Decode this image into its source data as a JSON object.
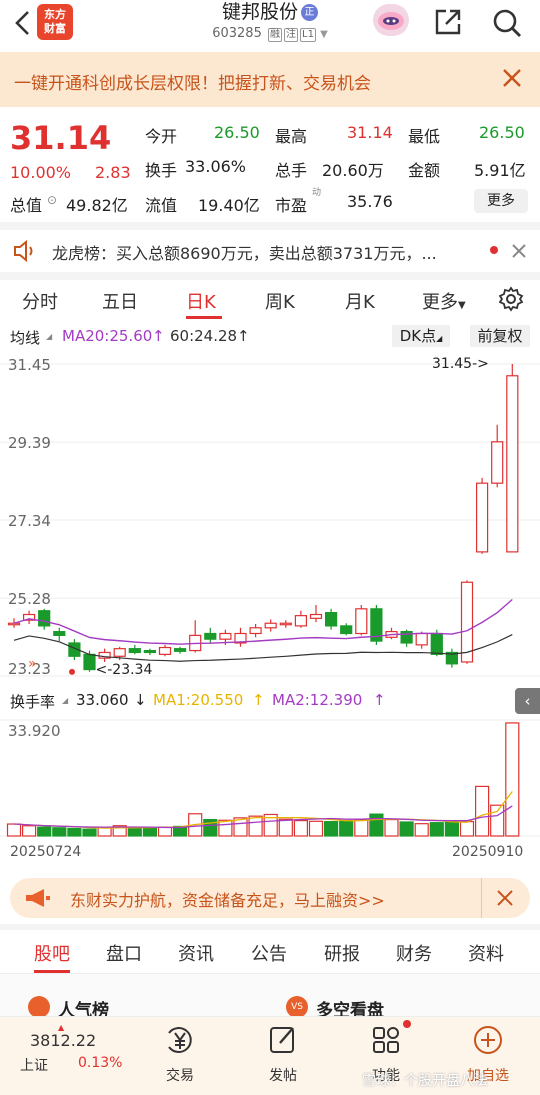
{
  "header": {
    "logo_text_1": "东方",
    "logo_text_2": "财富",
    "stock_name": "键邦股份",
    "name_badge": "正",
    "stock_code": "603285",
    "tags": [
      "融",
      "注",
      "L1"
    ]
  },
  "banner": {
    "text": "一键开通科创成长层权限！把握打新、交易机会"
  },
  "quote": {
    "price": "31.14",
    "change_pct": "10.00%",
    "change_amt": "2.83",
    "open_label": "今开",
    "open": "26.50",
    "high_label": "最高",
    "high": "31.14",
    "low_label": "最低",
    "low": "26.50",
    "turnover_label": "换手",
    "turnover": "33.06%",
    "volume_label": "总手",
    "volume": "20.60万",
    "amount_label": "金额",
    "amount": "5.91亿",
    "mktcap_label": "总值",
    "mktcap": "49.82亿",
    "float_label": "流值",
    "float": "19.40亿",
    "pe_label": "市盈",
    "pe_sup": "动",
    "pe": "35.76",
    "more": "更多"
  },
  "dragon_tiger": {
    "text": "龙虎榜：买入总额8690万元，卖出总额3731万元，..."
  },
  "period_tabs": [
    "分时",
    "五日",
    "日K",
    "周K",
    "月K",
    "更多"
  ],
  "chart_header": {
    "ma_label": "均线",
    "ma20": "MA20:25.60",
    "ma60": "60:24.28",
    "dk_label": "DK点",
    "adjust_label": "前复权"
  },
  "chart_data": {
    "type": "candlestick",
    "y_ticks": [
      "31.45",
      "29.39",
      "27.34",
      "25.28",
      "23.23"
    ],
    "ylim": [
      23.23,
      31.45
    ],
    "max_label": "31.45->",
    "min_label": "<-23.34",
    "candles": [
      {
        "o": 24.62,
        "c": 24.62,
        "h": 24.75,
        "l": 24.5
      },
      {
        "o": 24.7,
        "c": 24.85,
        "h": 24.95,
        "l": 24.6
      },
      {
        "o": 24.95,
        "c": 24.55,
        "h": 25.0,
        "l": 24.45
      },
      {
        "o": 24.4,
        "c": 24.3,
        "h": 24.5,
        "l": 24.15
      },
      {
        "o": 24.1,
        "c": 23.75,
        "h": 24.2,
        "l": 23.65
      },
      {
        "o": 23.8,
        "c": 23.4,
        "h": 23.9,
        "l": 23.34
      },
      {
        "o": 23.7,
        "c": 23.85,
        "h": 23.95,
        "l": 23.6
      },
      {
        "o": 23.75,
        "c": 23.95,
        "h": 24.0,
        "l": 23.65
      },
      {
        "o": 23.95,
        "c": 23.85,
        "h": 24.05,
        "l": 23.8
      },
      {
        "o": 23.9,
        "c": 23.85,
        "h": 23.95,
        "l": 23.78
      },
      {
        "o": 23.8,
        "c": 23.98,
        "h": 24.05,
        "l": 23.75
      },
      {
        "o": 23.95,
        "c": 23.88,
        "h": 24.0,
        "l": 23.82
      },
      {
        "o": 23.9,
        "c": 24.3,
        "h": 24.7,
        "l": 23.85
      },
      {
        "o": 24.35,
        "c": 24.2,
        "h": 24.5,
        "l": 24.1
      },
      {
        "o": 24.2,
        "c": 24.35,
        "h": 24.45,
        "l": 24.05
      },
      {
        "o": 24.1,
        "c": 24.35,
        "h": 24.5,
        "l": 24.0
      },
      {
        "o": 24.35,
        "c": 24.5,
        "h": 24.6,
        "l": 24.25
      },
      {
        "o": 24.5,
        "c": 24.62,
        "h": 24.72,
        "l": 24.4
      },
      {
        "o": 24.62,
        "c": 24.62,
        "h": 24.7,
        "l": 24.5
      },
      {
        "o": 24.55,
        "c": 24.82,
        "h": 24.95,
        "l": 24.5
      },
      {
        "o": 24.75,
        "c": 24.85,
        "h": 25.1,
        "l": 24.65
      },
      {
        "o": 24.9,
        "c": 24.55,
        "h": 25.0,
        "l": 24.45
      },
      {
        "o": 24.55,
        "c": 24.35,
        "h": 24.62,
        "l": 24.3
      },
      {
        "o": 24.35,
        "c": 25.0,
        "h": 25.1,
        "l": 24.3
      },
      {
        "o": 25.0,
        "c": 24.15,
        "h": 25.1,
        "l": 24.05
      },
      {
        "o": 24.25,
        "c": 24.4,
        "h": 24.5,
        "l": 24.2
      },
      {
        "o": 24.4,
        "c": 24.1,
        "h": 24.45,
        "l": 24.0
      },
      {
        "o": 24.05,
        "c": 24.35,
        "h": 24.4,
        "l": 23.95
      },
      {
        "o": 24.35,
        "c": 23.8,
        "h": 24.45,
        "l": 23.75
      },
      {
        "o": 23.85,
        "c": 23.55,
        "h": 23.95,
        "l": 23.45
      },
      {
        "o": 23.6,
        "c": 25.7,
        "h": 25.75,
        "l": 23.55
      },
      {
        "o": 26.5,
        "c": 28.31,
        "h": 28.45,
        "l": 26.45
      },
      {
        "o": 28.31,
        "c": 29.4,
        "h": 29.85,
        "l": 28.2
      },
      {
        "o": 26.5,
        "c": 31.14,
        "h": 31.45,
        "l": 26.5
      }
    ],
    "ma20_label": "MA20",
    "ma60_label": "MA60"
  },
  "volume_header": {
    "label": "换手率",
    "value": "33.060",
    "ma1": "MA1:20.550",
    "ma2": "MA2:12.390",
    "max_tick": "33.920"
  },
  "volume_data": [
    3.5,
    3.0,
    2.6,
    2.4,
    2.2,
    2.0,
    2.4,
    3.0,
    2.5,
    2.3,
    2.6,
    2.8,
    6.5,
    4.8,
    4.6,
    5.3,
    5.8,
    6.3,
    4.9,
    4.5,
    4.3,
    4.2,
    4.5,
    4.8,
    6.4,
    4.8,
    4.1,
    3.6,
    3.9,
    4.3,
    4.2,
    14.5,
    9.0,
    33.06
  ],
  "dates": {
    "start": "20250724",
    "end": "20250910"
  },
  "promo": {
    "text": "东财实力护航，资金储备充足，马上融资>>"
  },
  "section_tabs": [
    "股吧",
    "盘口",
    "资讯",
    "公告",
    "研报",
    "财务",
    "资料"
  ],
  "cards": {
    "popular": "人气榜",
    "long_short": "多空看盘"
  },
  "bottom_bar": {
    "index_value": "3812.22",
    "index_name": "上证",
    "index_change": "0.13%",
    "trade": "交易",
    "post": "发帖",
    "func": "功能",
    "add_watch": "加自选"
  },
  "watermark": "雪球：个股开盘八法",
  "colors": {
    "up": "#e03131",
    "down": "#1a9a2a",
    "ma20": "#a43bc3",
    "ma60": "#333333",
    "ma1": "#e8b400",
    "ma2": "#a43bc3"
  }
}
